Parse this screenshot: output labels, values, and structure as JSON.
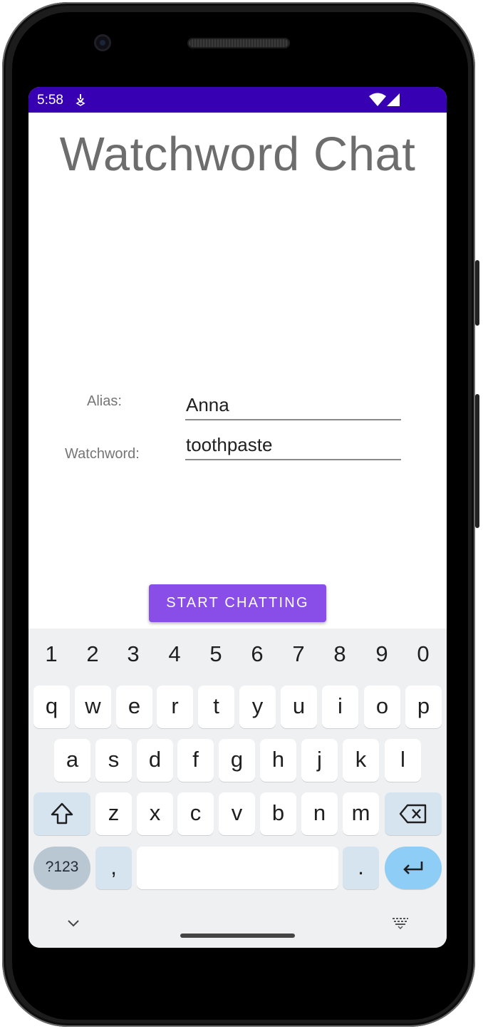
{
  "status_bar": {
    "time": "5:58"
  },
  "app": {
    "title": "Watchword Chat",
    "alias": {
      "label": "Alias:",
      "value": "Anna"
    },
    "watchword": {
      "label": "Watchword:",
      "value": "toothpaste"
    },
    "start_button": "START CHATTING",
    "accent_color": "#8a4ee8",
    "status_bar_color": "#3700b3"
  },
  "keyboard": {
    "number_row": [
      "1",
      "2",
      "3",
      "4",
      "5",
      "6",
      "7",
      "8",
      "9",
      "0"
    ],
    "row1": [
      "q",
      "w",
      "e",
      "r",
      "t",
      "y",
      "u",
      "i",
      "o",
      "p"
    ],
    "row2": [
      "a",
      "s",
      "d",
      "f",
      "g",
      "h",
      "j",
      "k",
      "l"
    ],
    "row3": [
      "z",
      "x",
      "c",
      "v",
      "b",
      "n",
      "m"
    ],
    "symbols_key": "?123",
    "comma_key": ",",
    "period_key": ".",
    "icons": [
      "shift-icon",
      "backspace-icon",
      "enter-icon",
      "chevron-down-icon",
      "keyboard-switch-icon"
    ]
  }
}
